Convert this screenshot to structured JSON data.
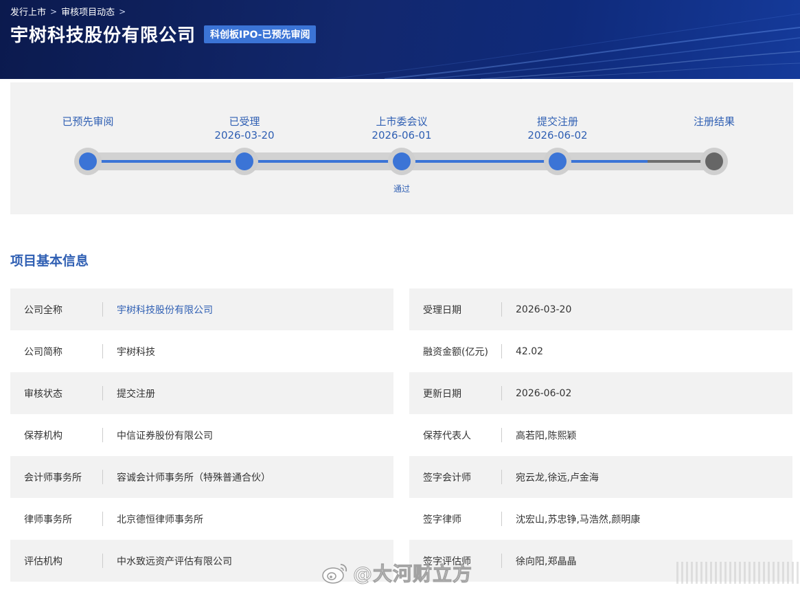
{
  "breadcrumb": {
    "items": [
      "发行上市",
      "审核项目动态"
    ],
    "separator": ">"
  },
  "header": {
    "title": "宇树科技股份有限公司",
    "badge": "科创板IPO-已预先审阅"
  },
  "progress": {
    "steps": [
      {
        "name": "已预先审阅",
        "date": "",
        "note": "",
        "status": "done"
      },
      {
        "name": "已受理",
        "date": "2026-03-20",
        "note": "",
        "status": "done"
      },
      {
        "name": "上市委会议",
        "date": "2026-06-01",
        "note": "通过",
        "status": "done"
      },
      {
        "name": "提交注册",
        "date": "2026-06-02",
        "note": "",
        "status": "done"
      },
      {
        "name": "注册结果",
        "date": "",
        "note": "",
        "status": "pending"
      }
    ]
  },
  "section": {
    "title": "项目基本信息"
  },
  "info": {
    "left": [
      {
        "label": "公司全称",
        "value": "宇树科技股份有限公司",
        "link": true
      },
      {
        "label": "公司简称",
        "value": "宇树科技",
        "link": false
      },
      {
        "label": "审核状态",
        "value": "提交注册",
        "link": false
      },
      {
        "label": "保荐机构",
        "value": "中信证券股份有限公司",
        "link": false
      },
      {
        "label": "会计师事务所",
        "value": "容诚会计师事务所（特殊普通合伙）",
        "link": false
      },
      {
        "label": "律师事务所",
        "value": "北京德恒律师事务所",
        "link": false
      },
      {
        "label": "评估机构",
        "value": "中水致远资产评估有限公司",
        "link": false
      }
    ],
    "right": [
      {
        "label": "受理日期",
        "value": "2026-03-20"
      },
      {
        "label": "融资金额(亿元)",
        "value": "42.02"
      },
      {
        "label": "更新日期",
        "value": "2026-06-02"
      },
      {
        "label": "保荐代表人",
        "value": "高若阳,陈熙颖"
      },
      {
        "label": "签字会计师",
        "value": "宛云龙,徐远,卢金海"
      },
      {
        "label": "签字律师",
        "value": "沈宏山,苏忠铮,马浩然,颜明康"
      },
      {
        "label": "签字评估师",
        "value": "徐向阳,郑晶晶"
      }
    ]
  },
  "watermark": {
    "text": "@大河财立方",
    "icon": "weibo-icon"
  },
  "colors": {
    "accent": "#3b74d6",
    "link": "#2f5fb3",
    "banner_dark": "#0b1a4e",
    "pending": "#666666"
  }
}
